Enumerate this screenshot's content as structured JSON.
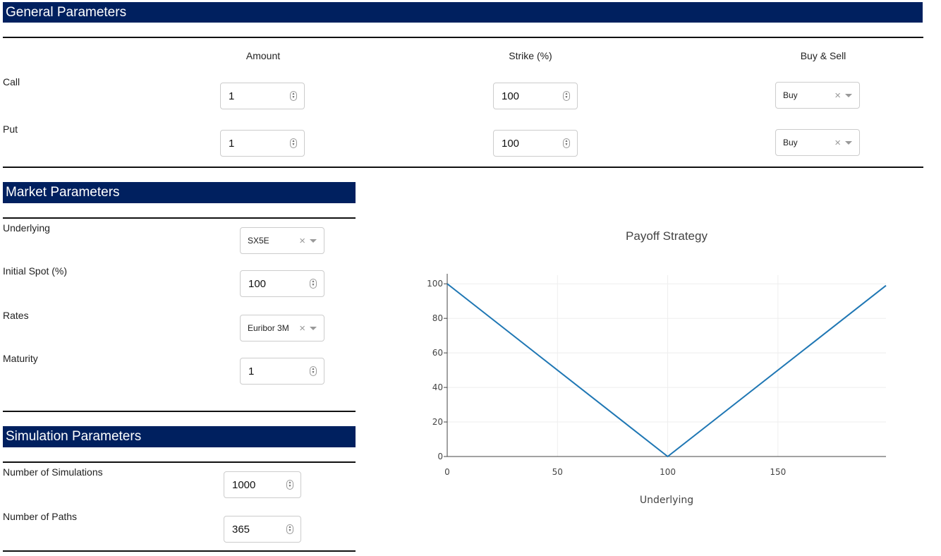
{
  "general": {
    "title": "General Parameters",
    "columns": {
      "amount": "Amount",
      "strike": "Strike (%)",
      "buysell": "Buy & Sell"
    },
    "rows": [
      {
        "label": "Call",
        "amount": "1",
        "strike": "100",
        "side": "Buy"
      },
      {
        "label": "Put",
        "amount": "1",
        "strike": "100",
        "side": "Buy"
      }
    ]
  },
  "market": {
    "title": "Market Parameters",
    "underlying_label": "Underlying",
    "underlying_value": "SX5E",
    "spot_label": "Initial Spot (%)",
    "spot_value": "100",
    "rates_label": "Rates",
    "rates_value": "Euribor 3M",
    "maturity_label": "Maturity",
    "maturity_value": "1"
  },
  "simulation": {
    "title": "Simulation Parameters",
    "sims_label": "Number of Simulations",
    "sims_value": "1000",
    "paths_label": "Number of Paths",
    "paths_value": "365"
  },
  "colors": {
    "header_bg": "#00205f",
    "line": "#1f77b4",
    "grid": "#eeeeee"
  },
  "chart_data": {
    "type": "line",
    "title": "Payoff Strategy",
    "xlabel": "Underlying",
    "ylabel": "",
    "xlim": [
      0,
      199
    ],
    "ylim": [
      0,
      105
    ],
    "x_ticks": [
      0,
      50,
      100,
      150
    ],
    "y_ticks": [
      0,
      20,
      40,
      60,
      80,
      100
    ],
    "grid": true,
    "series": [
      {
        "x": [
          0,
          100,
          199
        ],
        "y": [
          100,
          0,
          99
        ]
      }
    ]
  }
}
